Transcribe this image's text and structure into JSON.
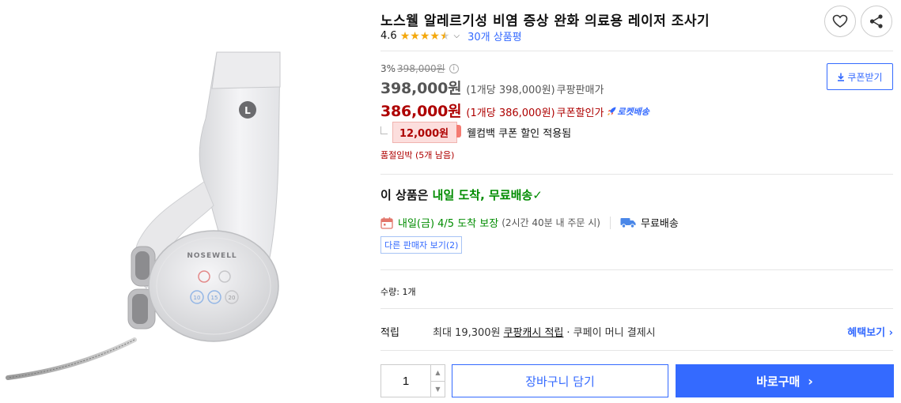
{
  "product": {
    "title": "노스웰 알레르기성 비염 증상 완화 의료용 레이저 조사기",
    "rating": "4.6",
    "stars": 4.5,
    "review_link": "30개 상품평"
  },
  "image": {
    "brand_text": "NOSEWELL",
    "side_badge": "L",
    "buttons": [
      "10",
      "15",
      "20"
    ]
  },
  "price": {
    "discount_rate": "3%",
    "original_price": "398,000원",
    "sale_price": "398,000원",
    "sale_unit": "(1개당 398,000원)",
    "sale_tag": "쿠팡판매가",
    "coupon_price": "386,000원",
    "coupon_unit": "(1개당 386,000원)",
    "coupon_tag": "쿠폰할인가",
    "rocket_label": "로켓배송",
    "coupon_button": "쿠폰받기"
  },
  "welcome": {
    "amount": "12,000원",
    "text": "웰컴백 쿠폰 할인 적용됨"
  },
  "stock": {
    "text": "품절임박 (5개 남음)"
  },
  "delivery": {
    "title_prefix": "이 상품은 ",
    "title_highlight": "내일 도착, 무료배송",
    "check": "✓",
    "arrive": "내일(금) 4/5 도착 보장",
    "arrive_note": "(2시간 40분 내 주문 시)",
    "free_shipping": "무료배송",
    "other_sellers": "다른 판매자 보기(2)"
  },
  "quantity": {
    "label": "수량: 1개",
    "value": "1"
  },
  "points": {
    "label": "적립",
    "text": "최대 19,300원",
    "link": "쿠팡캐시 적립",
    "extra": "· 쿠페이 머니 결제시",
    "benefit": "혜택보기 ›"
  },
  "actions": {
    "cart": "장바구니 담기",
    "buy": "바로구매",
    "buy_chevron": "›"
  },
  "colors": {
    "accent": "#346aff",
    "sale_red": "#ae0000",
    "delivery_green": "#008c00",
    "star": "#f4a80d"
  }
}
